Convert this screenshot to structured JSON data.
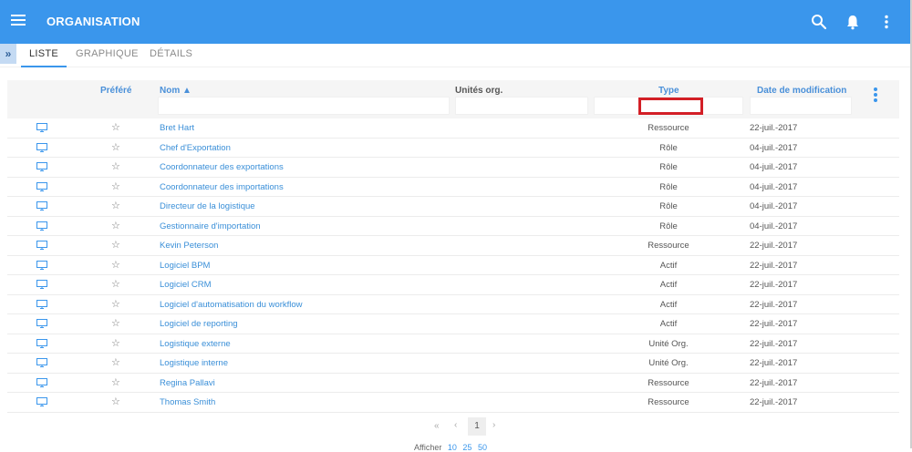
{
  "header": {
    "title": "ORGANISATION",
    "menu_icon": "menu-icon",
    "search_icon": "search-icon",
    "bell_icon": "bell-icon",
    "more_icon": "more-vertical-icon"
  },
  "tabs": [
    {
      "label": "LISTE",
      "active": true
    },
    {
      "label": "GRAPHIQUE",
      "active": false
    },
    {
      "label": "DÉTAILS",
      "active": false
    }
  ],
  "expander": "»",
  "table": {
    "headers": {
      "favorite": "Préféré",
      "name": "Nom ▲",
      "units": "Unités org.",
      "type": "Type",
      "date": "Date de modification"
    },
    "rows": [
      {
        "name": "Bret Hart",
        "type": "Ressource",
        "date": "22-juil.-2017"
      },
      {
        "name": "Chef d'Exportation",
        "type": "Rôle",
        "date": "04-juil.-2017"
      },
      {
        "name": "Coordonnateur des exportations",
        "type": "Rôle",
        "date": "04-juil.-2017"
      },
      {
        "name": "Coordonnateur des importations",
        "type": "Rôle",
        "date": "04-juil.-2017"
      },
      {
        "name": "Directeur de la logistique",
        "type": "Rôle",
        "date": "04-juil.-2017"
      },
      {
        "name": "Gestionnaire d'importation",
        "type": "Rôle",
        "date": "04-juil.-2017"
      },
      {
        "name": "Kevin Peterson",
        "type": "Ressource",
        "date": "22-juil.-2017"
      },
      {
        "name": "Logiciel BPM",
        "type": "Actif",
        "date": "22-juil.-2017"
      },
      {
        "name": "Logiciel CRM",
        "type": "Actif",
        "date": "22-juil.-2017"
      },
      {
        "name": "Logiciel d'automatisation du workflow",
        "type": "Actif",
        "date": "22-juil.-2017"
      },
      {
        "name": "Logiciel de reporting",
        "type": "Actif",
        "date": "22-juil.-2017"
      },
      {
        "name": "Logistique externe",
        "type": "Unité Org.",
        "date": "22-juil.-2017"
      },
      {
        "name": "Logistique interne",
        "type": "Unité Org.",
        "date": "22-juil.-2017"
      },
      {
        "name": "Regina Pallavi",
        "type": "Ressource",
        "date": "22-juil.-2017"
      },
      {
        "name": "Thomas Smith",
        "type": "Ressource",
        "date": "22-juil.-2017"
      }
    ]
  },
  "pagination": {
    "first": "«",
    "prev": "‹",
    "page": "1",
    "next": "›"
  },
  "page_size": {
    "label": "Afficher",
    "options": [
      "10",
      "25",
      "50"
    ]
  },
  "colors": {
    "primary": "#3a96ec",
    "highlight": "#d31f26"
  }
}
